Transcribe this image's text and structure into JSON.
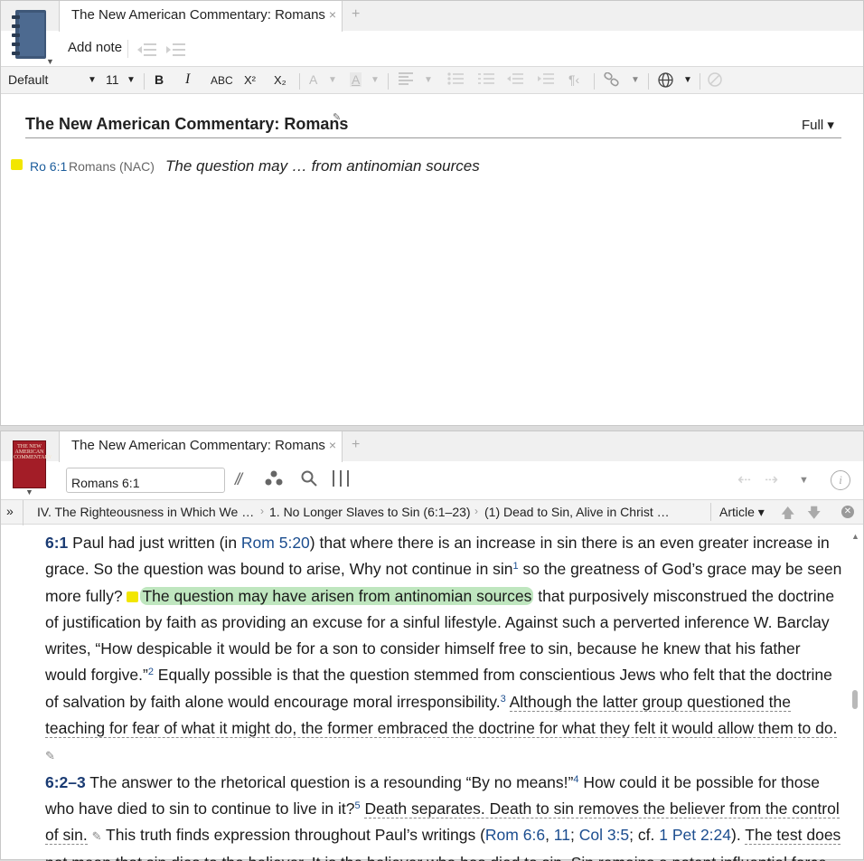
{
  "notes_pane": {
    "tab_title": "The New American Commentary: Romans",
    "tab_close": "×",
    "tab_add": "+",
    "toolbar": {
      "add_note_label": "Add note",
      "outdent_icon": "outdent-icon",
      "indent_icon": "indent-icon"
    },
    "format_bar": {
      "style": "Default",
      "font_size": "11",
      "bold": "B",
      "italic": "I",
      "smallcaps": "ABC",
      "superscript": "X²",
      "subscript": "X₂",
      "font_color": "A",
      "highlight_color": "A",
      "caret": "▼"
    },
    "note": {
      "title": "The New American Commentary: Romans",
      "view_mode": "Full ▾",
      "reference": "Ro 6:1",
      "source": "Romans (NAC)",
      "text": "The question may … from antinomian sources",
      "flag_color": "#f2e600"
    }
  },
  "resource_pane": {
    "tab_title": "The New American Commentary: Romans",
    "tab_close": "×",
    "tab_add": "+",
    "book_cover_text": "THE NEW AMERICAN COMMENTARY",
    "reference_input": "Romans 6:1",
    "breadcrumb": {
      "expand": "»",
      "items": [
        "IV. The Righteousness in Which We …",
        "1. No Longer Slaves to Sin (6:1–23)",
        "(1) Dead to Sin, Alive in Christ …"
      ],
      "separator": "›",
      "view": "Article ▾"
    },
    "article": {
      "p1_vnum": "6:1",
      "p1_a": " Paul had just written (in ",
      "p1_ref1": "Rom 5:20",
      "p1_b": ") that where there is an increase in sin there is an even greater increase in grace. So the question was bound to arise, Why not continue in sin",
      "p1_fn1": "1",
      "p1_c": " so the greatness of God’s grace may be seen more fully? ",
      "p1_highlight": "The question may have arisen from antinomian sources",
      "p1_d": " that purposively misconstrued the doctrine of justification by faith as providing an excuse for a sinful lifestyle. Against such a perverted inference W. Barclay writes, “How despicable it would be for a son to consider himself free to sin, because he knew that his father would forgive.”",
      "p1_fn2": "2",
      "p1_e": " Equally possible is that the question stemmed from conscientious Jews who felt that the doctrine of salvation by faith alone would encourage moral irresponsibility.",
      "p1_fn3": "3",
      "p1_f": " ",
      "p1_dotted": "Although the latter group questioned the teaching for fear of what it might do, the former embraced the doctrine for what they felt it would allow them to do.",
      "p2_vnum": "6:2–3",
      "p2_a": " The answer to the rhetorical question is a resounding “By no means!”",
      "p2_fn4": "4",
      "p2_b": " How could it be possible for those who have died to sin to continue to live in it?",
      "p2_fn5": "5",
      "p2_c": " ",
      "p2_dotted": "Death separates. Death to sin removes the believer from the control of sin.",
      "p2_d": " This truth finds expression throughout Paul’s writings (",
      "p2_ref1": "Rom 6:6",
      "p2_sep1": ", ",
      "p2_ref2": "11",
      "p2_sep2": "; ",
      "p2_ref3": "Col 3:5",
      "p2_sep3": "; cf. ",
      "p2_ref4": "1 Pet 2:24",
      "p2_e": "). ",
      "p2_dotted2": "The test does not mean that sin dies to the believer. It is the believer who has died to sin. Sin remains a potent influential force"
    }
  }
}
